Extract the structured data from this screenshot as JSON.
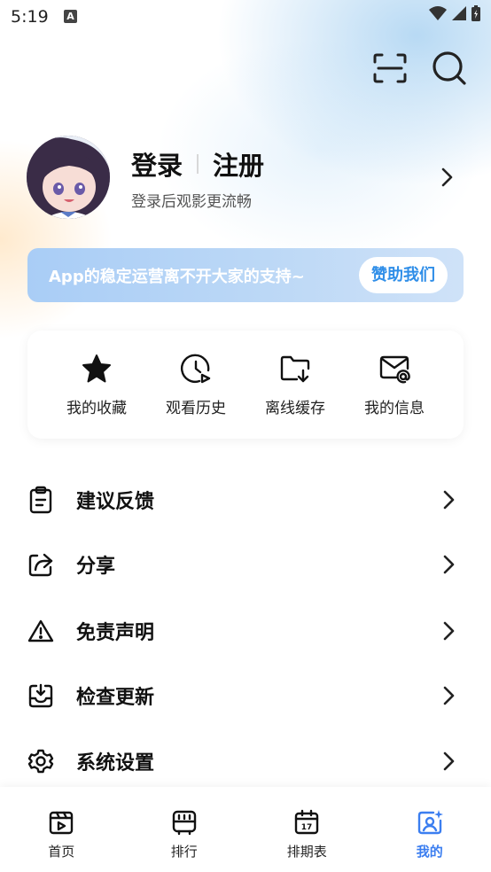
{
  "status_bar": {
    "time": "5:19",
    "notification_icon": "A"
  },
  "header": {
    "scan_icon": "scan-icon",
    "search_icon": "search-icon"
  },
  "profile": {
    "login_label": "登录",
    "register_label": "注册",
    "subtitle": "登录后观影更流畅"
  },
  "banner": {
    "text": "App的稳定运营离不开大家的支持~",
    "button_label": "赞助我们"
  },
  "quick_actions": [
    {
      "label": "我的收藏",
      "icon": "star-icon"
    },
    {
      "label": "观看历史",
      "icon": "history-icon"
    },
    {
      "label": "离线缓存",
      "icon": "download-folder-icon"
    },
    {
      "label": "我的信息",
      "icon": "mail-icon"
    }
  ],
  "menu": [
    {
      "label": "建议反馈",
      "icon": "feedback-icon"
    },
    {
      "label": "分享",
      "icon": "share-icon"
    },
    {
      "label": "免责声明",
      "icon": "warning-icon"
    },
    {
      "label": "检查更新",
      "icon": "update-icon"
    },
    {
      "label": "系统设置",
      "icon": "settings-icon"
    }
  ],
  "bottom_nav": {
    "items": [
      {
        "label": "首页",
        "icon": "home-icon"
      },
      {
        "label": "排行",
        "icon": "ranking-icon"
      },
      {
        "label": "排期表",
        "icon": "calendar-icon"
      },
      {
        "label": "我的",
        "icon": "profile-icon"
      }
    ],
    "active": "我的",
    "active_color": "#3b7ef0"
  }
}
